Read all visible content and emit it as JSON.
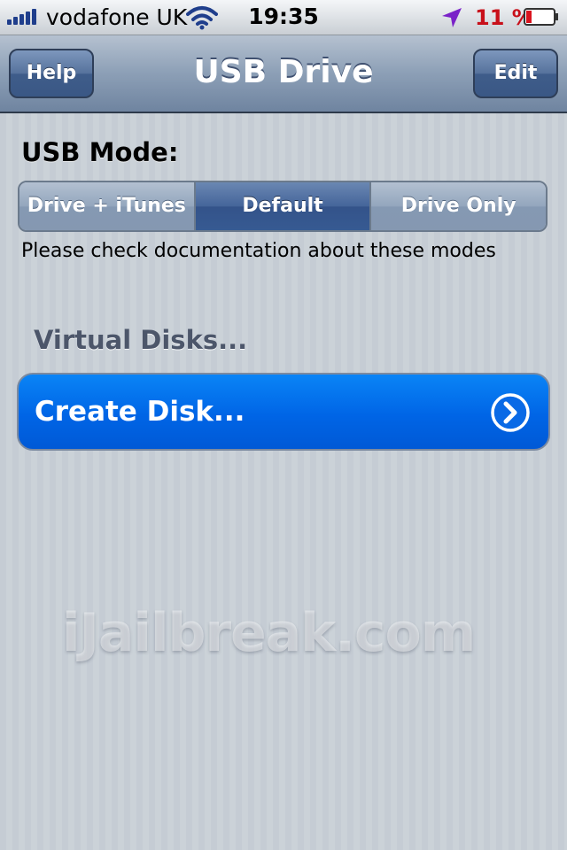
{
  "status_bar": {
    "carrier": "vodafone UK",
    "time": "19:35",
    "battery_percent": "11 %",
    "signal_bars": 5,
    "icons": [
      "signal-bars-icon",
      "wifi-icon",
      "location-arrow-icon",
      "battery-icon"
    ]
  },
  "nav": {
    "title": "USB Drive",
    "left_button": "Help",
    "right_button": "Edit"
  },
  "usb_mode": {
    "label": "USB Mode:",
    "segments": [
      "Drive + iTunes",
      "Default",
      "Drive Only"
    ],
    "selected": "Default",
    "hint": "Please check documentation about these modes"
  },
  "virtual_disks": {
    "header": "Virtual Disks...",
    "create_label": "Create Disk...",
    "icon": "disclosure-chevron-icon"
  },
  "watermark": "iJailbreak.com",
  "colors": {
    "nav_bar": "#8c9fb6",
    "selected_segment": "#45659a",
    "cell_blue": "#0065e6",
    "battery_red": "#c8101a",
    "background": "#c5ccd4"
  }
}
